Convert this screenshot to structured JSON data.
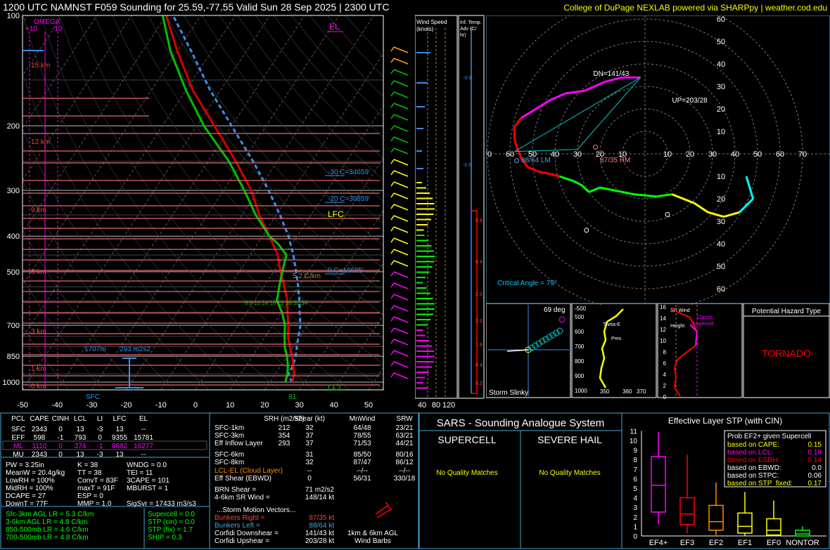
{
  "header": {
    "title": "1200 UTC NAMNST F059 Sounding for 25.59,-77.55 Valid  Sun 28 Sep 2025 | 2300 UTC",
    "credit": "College of DuPage NEXLAB powered via SHARPpy | weather.cod.edu"
  },
  "colors": {
    "temperature": "#d40000",
    "dewpoint": "#00c000",
    "parcel": "#3a8fe8",
    "panel_border": "#4aa3d8",
    "accent_yellow": "#ffff00",
    "magenta": "#ff00ff"
  },
  "chart_data": [
    {
      "type": "line",
      "name": "skewt",
      "ylabel_ticks": [
        "100",
        "200",
        "300",
        "400",
        "500",
        "700",
        "850",
        "1000"
      ],
      "y_log_scale": true,
      "xlim": [
        -50,
        50
      ],
      "x_ticks": [
        "-50",
        "-40",
        "-30",
        "-20",
        "-10",
        "0",
        "10",
        "20",
        "30",
        "40",
        "50"
      ],
      "height_labels": [
        "15 km",
        "12 km",
        "9 km",
        "6 km",
        "3 km",
        "1 km",
        "0 km"
      ],
      "omega_label": "OMEGA",
      "omega_ticks": [
        "+10",
        "-10"
      ],
      "annotations": {
        "el": "EL",
        "lfc": "LFC",
        "lcl": "LCL",
        "minus30": "-30 C=34659'",
        "minus20": "-20 C=30859'",
        "wbz": "0 C=19605'",
        "lapse": "5.2 C/km",
        "pbl_left": "1707m",
        "pbl_right": "293 m2s2",
        "sfc": "SFC",
        "sfc_temp": "81",
        "isotherms": "6 8 10 14 16 22 26 30 34"
      },
      "temperature_series": {
        "name": "Temperature",
        "points": [
          [
            26.5,
            1000
          ],
          [
            25.5,
            950
          ],
          [
            23.5,
            900
          ],
          [
            21.5,
            850
          ],
          [
            19,
            800
          ],
          [
            16.5,
            750
          ],
          [
            14.5,
            700
          ],
          [
            12,
            650
          ],
          [
            9.5,
            600
          ],
          [
            6,
            550
          ],
          [
            2,
            500
          ],
          [
            -2,
            450
          ],
          [
            -8,
            400
          ],
          [
            -15,
            350
          ],
          [
            -22,
            300
          ],
          [
            -32,
            250
          ],
          [
            -45,
            200
          ],
          [
            -58,
            160
          ],
          [
            -70,
            125
          ],
          [
            -80,
            100
          ]
        ]
      },
      "dewpoint_series": {
        "name": "Dewpoint",
        "points": [
          [
            24.5,
            1000
          ],
          [
            23.5,
            950
          ],
          [
            22,
            900
          ],
          [
            20,
            850
          ],
          [
            17.5,
            800
          ],
          [
            15.5,
            750
          ],
          [
            13.5,
            700
          ],
          [
            10.5,
            650
          ],
          [
            6.5,
            600
          ],
          [
            4.5,
            550
          ],
          [
            2.5,
            500
          ],
          [
            0.5,
            450
          ],
          [
            -4,
            420
          ],
          [
            -8,
            400
          ],
          [
            -16,
            350
          ],
          [
            -24,
            300
          ],
          [
            -34,
            250
          ],
          [
            -48,
            200
          ],
          [
            -60,
            160
          ],
          [
            -72,
            125
          ],
          [
            -81,
            100
          ]
        ]
      },
      "parcel_series": {
        "name": "Parcel",
        "points": [
          [
            26.5,
            1000
          ],
          [
            24,
            960
          ],
          [
            23.5,
            900
          ],
          [
            22.5,
            850
          ],
          [
            21,
            800
          ],
          [
            19.5,
            750
          ],
          [
            18,
            700
          ],
          [
            15.5,
            650
          ],
          [
            13,
            600
          ],
          [
            10,
            550
          ],
          [
            6.5,
            500
          ],
          [
            2.5,
            450
          ],
          [
            -2.5,
            400
          ],
          [
            -9,
            350
          ],
          [
            -17,
            300
          ],
          [
            -27,
            250
          ],
          [
            -40,
            200
          ],
          [
            -53,
            160
          ],
          [
            -66,
            125
          ],
          [
            -78,
            100
          ]
        ]
      }
    },
    {
      "type": "line",
      "name": "hodograph",
      "x_ticks": [
        "70",
        "60",
        "50",
        "40",
        "30",
        "20",
        "10",
        "10",
        "20",
        "30",
        "40",
        "50",
        "60",
        "70"
      ],
      "y_ticks": [
        "60",
        "50",
        "40",
        "30",
        "20",
        "10",
        "10",
        "20",
        "30",
        "40",
        "50",
        "60"
      ],
      "labels": {
        "dn": "DN=141/43",
        "up": "UP=203/28",
        "left_mover": "88/64 LM",
        "right_mover": "87/35 RM",
        "critical_angle": "Critical Angle = 79°"
      },
      "points_kt": [
        [
          45,
          -10
        ],
        [
          48,
          -20
        ],
        [
          45,
          -23
        ],
        [
          42,
          -26
        ],
        [
          35,
          -28
        ],
        [
          28,
          -26
        ],
        [
          22,
          -22
        ],
        [
          12,
          -18
        ],
        [
          5,
          -19
        ],
        [
          -5,
          -18
        ],
        [
          -15,
          -16
        ],
        [
          -20,
          -15
        ],
        [
          -25,
          -17
        ],
        [
          -28,
          -14
        ],
        [
          -32,
          -12
        ],
        [
          -38,
          -10
        ],
        [
          -42,
          -9
        ],
        [
          -47,
          -8
        ],
        [
          -52,
          -6
        ],
        [
          -55,
          -2
        ],
        [
          -57,
          3
        ],
        [
          -58,
          7
        ],
        [
          -58,
          12
        ],
        [
          -55,
          16
        ],
        [
          -50,
          19
        ],
        [
          -42,
          24
        ],
        [
          -35,
          27
        ],
        [
          -27,
          28
        ],
        [
          -18,
          32
        ],
        [
          -10,
          34
        ],
        [
          -2,
          34
        ]
      ]
    },
    {
      "type": "bar",
      "name": "effective-layer-stp",
      "title": "Effective Layer STP (with CIN)",
      "categories": [
        "EF4+",
        "EF3",
        "EF2",
        "EF1",
        "EF0",
        "NONTOR"
      ],
      "y_ticks": [
        "0",
        "1",
        "2",
        "3",
        "4",
        "5",
        "6",
        "7",
        "8",
        "9",
        "10",
        "11"
      ],
      "boxes": [
        {
          "low": 1.2,
          "q1": 2.5,
          "median": 5.3,
          "q3": 8.3,
          "high": 10.9,
          "color": "#ff00ff"
        },
        {
          "low": 0.3,
          "q1": 1.2,
          "median": 2.3,
          "q3": 4.0,
          "high": 8.5,
          "color": "#ff0000"
        },
        {
          "low": 0.1,
          "q1": 0.6,
          "median": 1.5,
          "q3": 3.2,
          "high": 5.6,
          "color": "#ff8c00"
        },
        {
          "low": 0.0,
          "q1": 0.3,
          "median": 1.0,
          "q3": 2.4,
          "high": 4.6,
          "color": "#ffff00"
        },
        {
          "low": 0.0,
          "q1": 0.1,
          "median": 0.6,
          "q3": 1.8,
          "high": 3.7,
          "color": "#ffff00"
        },
        {
          "low": 0.0,
          "q1": 0.0,
          "median": 0.2,
          "q3": 0.6,
          "high": 1.0,
          "color": "#00ff00"
        }
      ],
      "prob_title": "Prob EF2+ given Supercell",
      "prob_rows": [
        {
          "label": "based on CAPE:",
          "value": "0.15",
          "color": "#ffff00"
        },
        {
          "label": "based on LCL:",
          "value": "0.19",
          "color": "#ff00ff"
        },
        {
          "label": "based on ESRH:",
          "value": "0.14",
          "color": "#ff0000"
        },
        {
          "label": "based on EBWD:",
          "value": "0.0",
          "color": "#ffffff"
        },
        {
          "label": "based on STPC:",
          "value": "0.06",
          "color": "#ffffff"
        },
        {
          "label": "based on STP_fixed:",
          "value": "0.17",
          "color": "#ffff00"
        }
      ]
    }
  ],
  "wind_speed_panel": {
    "title": "Wind Speed (knots)",
    "ticks": [
      "40",
      "80",
      "120"
    ]
  },
  "inf_temp_panel": {
    "title": "Inf. Temp. Adv (C/hr)",
    "ticks": [
      "-0.9",
      "-0.5",
      "0.8",
      "0.4",
      "2.0",
      "3.0",
      "1.9",
      "0.4",
      "0.2"
    ]
  },
  "storm_slinky": {
    "title": "Storm Slinky",
    "angle": "69 deg"
  },
  "theta_panel": {
    "label1": "Theta-E",
    "label2": "Pres",
    "ticks_y": [
      "500",
      "600",
      "700",
      "800",
      "900",
      "1000"
    ],
    "ticks_x": [
      "350",
      "360",
      "370"
    ],
    "top_tick": "-500"
  },
  "sr_wind_panel": {
    "title": "SR Wind vs Height",
    "supercell": "Classic Supercell",
    "y_ticks": [
      "0",
      "2",
      "4",
      "6",
      "8",
      "10",
      "12",
      "14",
      "16"
    ]
  },
  "hazard": {
    "title": "Potential Hazard Type",
    "value": "TORNADO"
  },
  "parcel_table": {
    "headers": [
      "PCL",
      "CAPE",
      "CINH",
      "LCL",
      "LI",
      "LFC",
      "EL"
    ],
    "rows": [
      [
        "SFC",
        "2343",
        "0",
        "13",
        "-3",
        "13",
        "--"
      ],
      [
        "EFF",
        "598",
        "-1",
        "793",
        "0",
        "9355",
        "15781"
      ],
      [
        "ML",
        "1110",
        "0",
        "374",
        "-1",
        "8682",
        "16277"
      ],
      [
        "MU",
        "2343",
        "0",
        "13",
        "-3",
        "13",
        "--"
      ]
    ]
  },
  "indices": {
    "col1": [
      "PW = 3.25in",
      "MeanW = 20.4g/kg",
      "LowRH = 100%",
      "MidRH = 100%",
      "DCAPE = 27",
      "DownT = 77F"
    ],
    "col2": [
      "K = 38",
      "TT = 38",
      "ConvT = 83F",
      "maxT = 91F",
      "ESP = 0",
      "MMP = 1.0"
    ],
    "col3": [
      "WNDG = 0.0",
      "TEI = 11",
      "3CAPE = 101",
      "MBURST = 1",
      "",
      "SigSvr = 17433 m3/s3"
    ]
  },
  "lapse": {
    "col1": [
      "Sfc-3km AGL LR = 5.3 C/km",
      "3-6km AGL LR = 4.8 C/km",
      "850-500mb LR = 4.6 C/km",
      "700-500mb LR = 4.8 C/km"
    ],
    "col2": [
      "Supercell = 0.0",
      "STP (cin) = 0.0",
      "STP (fix) = 1.7",
      "SHIP = 0.3"
    ]
  },
  "kinematics": {
    "headers": [
      "SRH (m2/s2)",
      "Shear (kt)",
      "MnWind",
      "SRW"
    ],
    "rows": [
      [
        "SFC-1km",
        "212",
        "32",
        "64/48",
        "23/21"
      ],
      [
        "SFC-3km",
        "354",
        "37",
        "78/55",
        "63/21"
      ],
      [
        "Eff Inflow Layer",
        "293",
        "37",
        "71/53",
        "44/21"
      ],
      [
        "SFC-6km",
        "",
        "31",
        "85/50",
        "80/16"
      ],
      [
        "SFC-8km",
        "",
        "32",
        "87/47",
        "86/12"
      ],
      [
        "LCL-EL (Cloud Layer)",
        "",
        "--",
        "--/--",
        "--/--"
      ],
      [
        "Eff Shear (EBWD)",
        "",
        "0",
        "56/31",
        "330/18"
      ]
    ],
    "brn": "BRN Shear =",
    "brn_val": "71 m2/s2",
    "sr_wind": "4-6km SR Wind =",
    "sr_wind_val": "148/14 kt",
    "storm_motion": "...Storm Motion Vectors...",
    "bunkers_right": "Bunkers Right =",
    "bunkers_right_val": "87/35 kt",
    "bunkers_left": "Bunkers Left =",
    "bunkers_left_val": "88/64 kt",
    "corfidi_down": "Corfidi Downshear =",
    "corfidi_down_val": "141/43 kt",
    "corfidi_up": "Corfidi Upshear =",
    "corfidi_up_val": "203/28 kt",
    "barbs_label": "1km & 6km AGL Wind Barbs"
  },
  "sars": {
    "title": "SARS - Sounding Analogue System",
    "supercell": "SUPERCELL",
    "hail": "SEVERE HAIL",
    "no_match": "No Quality Matches"
  }
}
